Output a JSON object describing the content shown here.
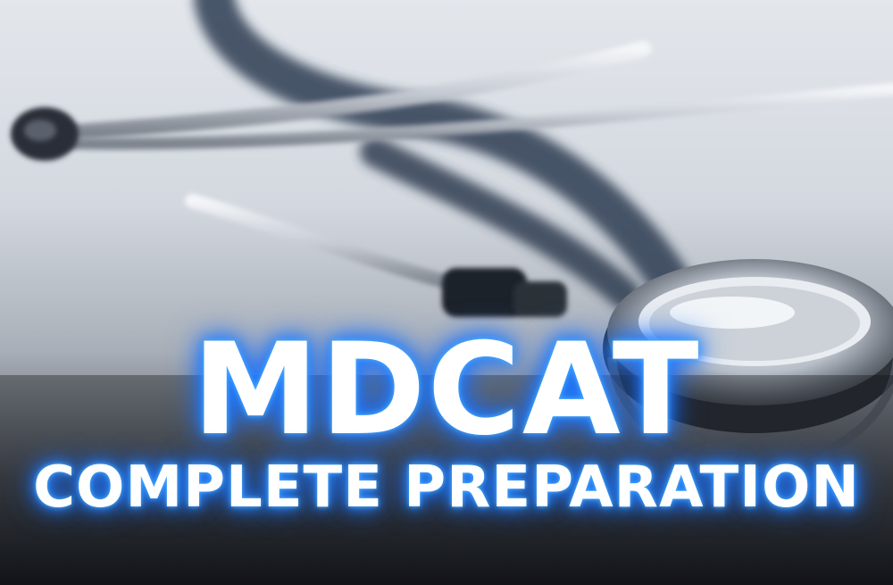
{
  "headline": {
    "main": "MDCAT",
    "sub": "COMPLETE PREPARATION"
  },
  "colors": {
    "text": "#ffffff",
    "glow": "#2d8cff"
  }
}
